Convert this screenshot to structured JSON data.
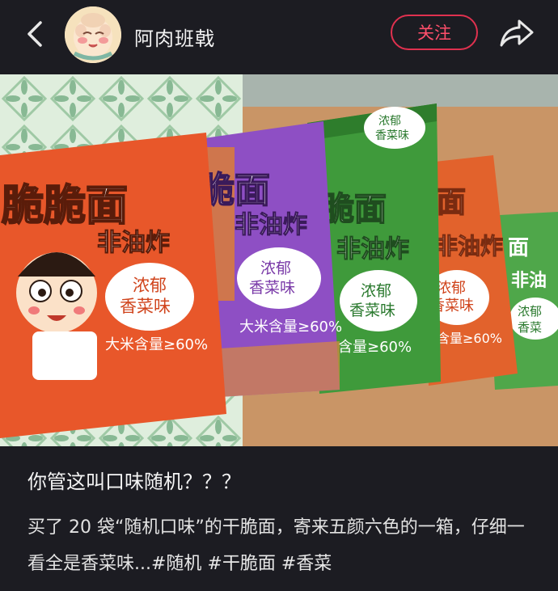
{
  "header": {
    "username": "阿肉班戟",
    "follow_label": "关注"
  },
  "photo": {
    "bags": [
      {
        "color": "#e8572a",
        "brand": "脆脆面",
        "sub": "非油炸",
        "bubble": "浓郁\n香菜味",
        "note": "大米含量≥60%"
      },
      {
        "color": "#8e4fc4",
        "brand": "脆面",
        "sub": "非油炸",
        "bubble": "浓郁\n香菜味",
        "note": "大米含量≥60%"
      },
      {
        "color": "#3f9a3b",
        "brand": "脆面",
        "sub": "非油炸",
        "bubble": "浓郁\n香菜味",
        "note": "含量≥60%"
      },
      {
        "color": "#e2622c",
        "brand": "面",
        "sub": "非油炸",
        "bubble": "浓郁\n香菜味",
        "note": "含量≥60%"
      },
      {
        "color": "#3f9a3b",
        "brand": "面",
        "sub": "非油",
        "bubble": "浓郁\n香菜味",
        "note": ""
      }
    ],
    "top_tag": "浓郁\n香菜味"
  },
  "post": {
    "title": "你管这叫口味随机？？？",
    "description": "买了 20 袋“随机口味”的干脆面，寄来五颜六色的一箱，仔细一看全是香菜味...",
    "hashtags": "#随机 #干脆面 #香菜"
  }
}
